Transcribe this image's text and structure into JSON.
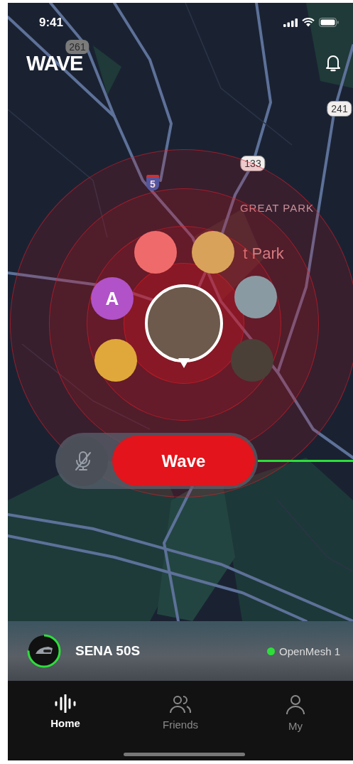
{
  "status_bar": {
    "time": "9:41"
  },
  "header": {
    "logo": "WAVE"
  },
  "map": {
    "labels": [
      {
        "kind": "shield-grey",
        "text": "261"
      },
      {
        "kind": "shield-white",
        "text": "241"
      },
      {
        "kind": "shield-interstate",
        "text": "5"
      },
      {
        "kind": "shield-white",
        "text": "133"
      },
      {
        "kind": "place",
        "text": "GREAT PARK"
      },
      {
        "kind": "poi",
        "text": "t Park"
      }
    ]
  },
  "friends": [
    {
      "kind": "photo",
      "color": "#ef6b6b"
    },
    {
      "kind": "photo",
      "color": "#d9a25a"
    },
    {
      "kind": "initial",
      "initial": "A",
      "color": "#b152c9"
    },
    {
      "kind": "photo",
      "color": "#8a9aa3"
    },
    {
      "kind": "photo",
      "color": "#e0a83a"
    },
    {
      "kind": "photo",
      "color": "#4a4038"
    }
  ],
  "me": {
    "kind": "photo"
  },
  "wave_control": {
    "mic_muted": true,
    "button": "Wave"
  },
  "device": {
    "name": "SENA 50S",
    "level": 0.75,
    "network": "OpenMesh 1",
    "connected": true
  },
  "tabs": [
    {
      "label": "Home",
      "kind": "waveform",
      "selected": true
    },
    {
      "label": "Friends",
      "kind": "people",
      "selected": false
    },
    {
      "label": "My",
      "kind": "person",
      "selected": false
    }
  ]
}
